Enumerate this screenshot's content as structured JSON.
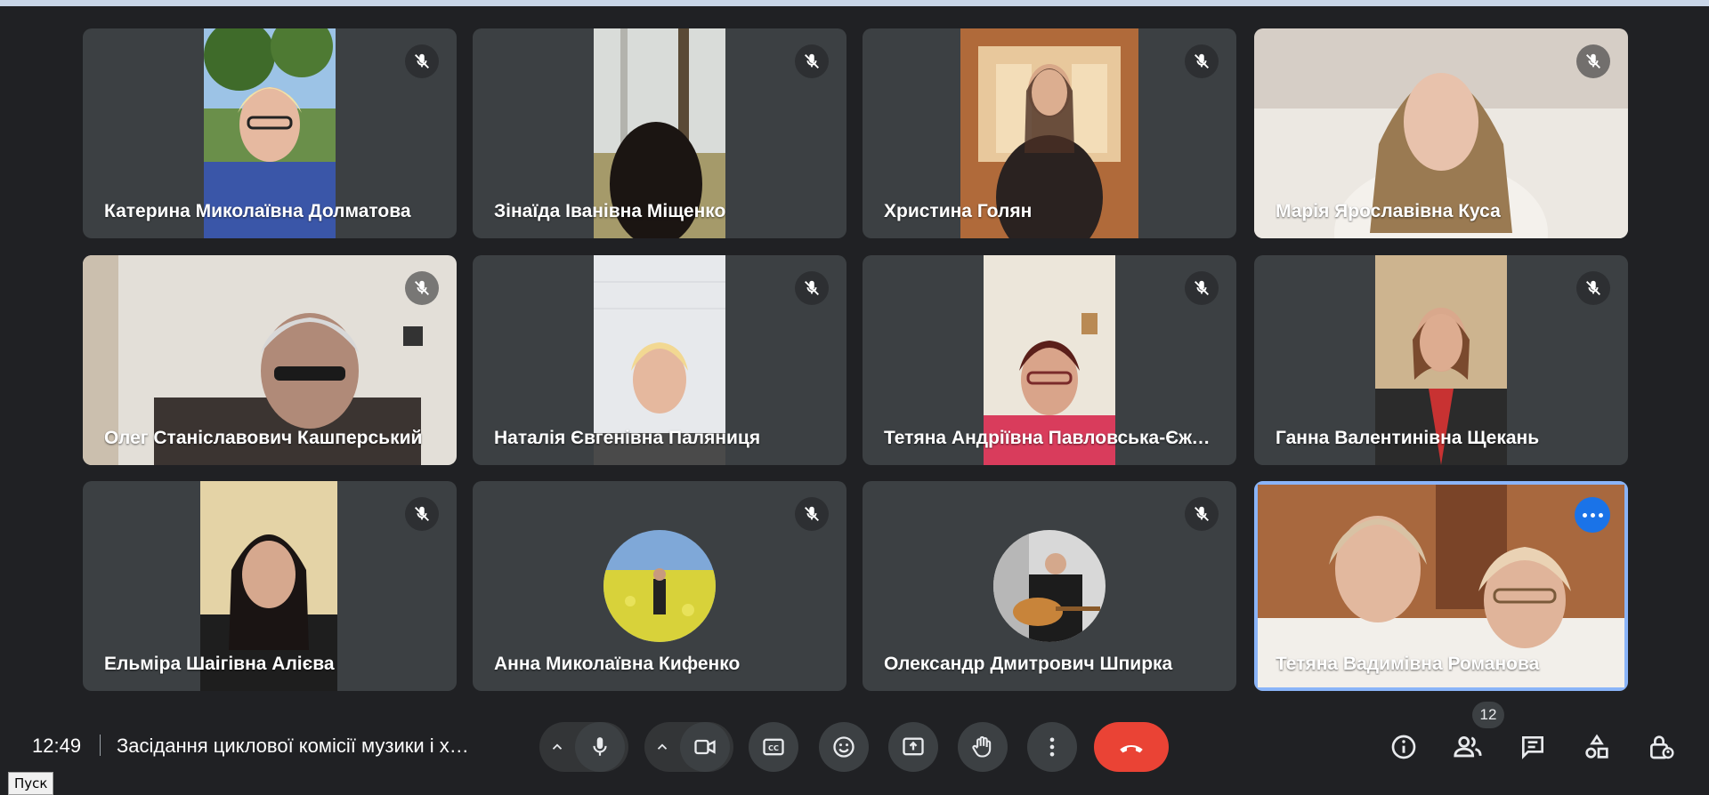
{
  "participants": [
    {
      "name": "Катерина Миколаївна Долматова",
      "muted": true
    },
    {
      "name": "Зінаїда Іванівна Міщенко",
      "muted": true
    },
    {
      "name": "Христина Голян",
      "muted": true
    },
    {
      "name": "Марія Ярославівна Куса",
      "muted": true
    },
    {
      "name": "Олег Станіславович Кашперський",
      "muted": true
    },
    {
      "name": "Наталія Євгенівна Паляниця",
      "muted": true
    },
    {
      "name": "Тетяна Андріївна Павловська-Єжо…",
      "muted": true
    },
    {
      "name": "Ганна Валентинівна Щекань",
      "muted": true
    },
    {
      "name": "Ельміра Шаігівна Алієва",
      "muted": true
    },
    {
      "name": "Анна Миколаївна Кифенко",
      "muted": true
    },
    {
      "name": "Олександр Дмитрович Шпирка",
      "muted": true
    },
    {
      "name": "Тетяна Вадимівна Романова",
      "muted": false
    }
  ],
  "bottom_bar": {
    "time": "12:49",
    "meeting_title": "Засідання циклової комісії музики і х…",
    "participants_count": "12"
  },
  "icons": {
    "mic": "mic-icon",
    "camera": "camera-icon",
    "captions": "captions-icon",
    "emoji": "emoji-icon",
    "present": "present-screen-icon",
    "raise_hand": "raise-hand-icon",
    "more": "more-vertical-icon",
    "end_call": "end-call-icon",
    "info": "info-icon",
    "people": "people-icon",
    "chat": "chat-icon",
    "activities": "activities-icon",
    "host_controls": "host-controls-icon"
  },
  "colors": {
    "background": "#202124",
    "tile": "#3c4043",
    "active_outline": "#8ab4f8",
    "end_call": "#ea4335",
    "accent": "#1a73e8"
  },
  "taskbar": {
    "start_label": "Пуск"
  }
}
